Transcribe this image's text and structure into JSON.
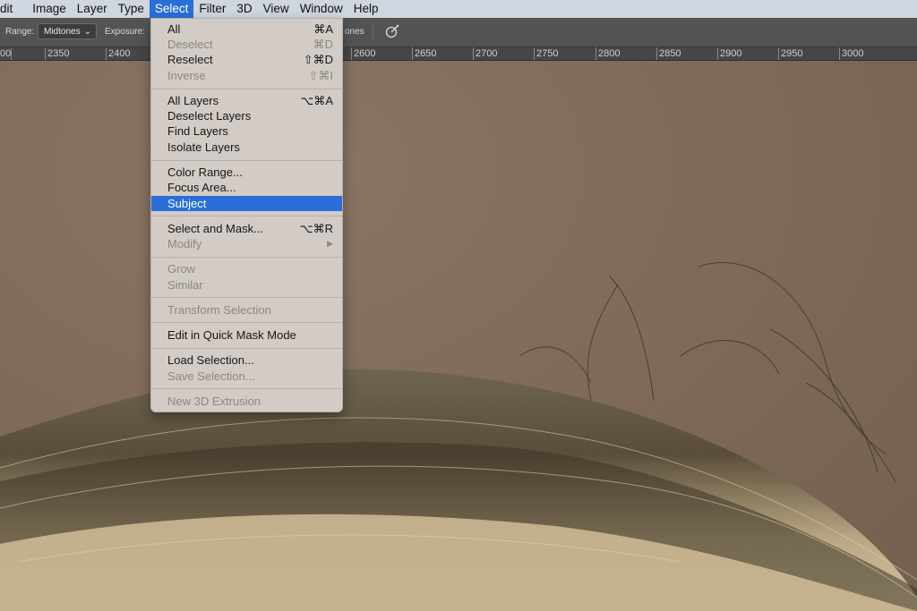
{
  "menubar": {
    "items": [
      {
        "label": "dit"
      },
      {
        "label": "Image"
      },
      {
        "label": "Layer"
      },
      {
        "label": "Type"
      },
      {
        "label": "Select",
        "active": true
      },
      {
        "label": "Filter"
      },
      {
        "label": "3D"
      },
      {
        "label": "View"
      },
      {
        "label": "Window"
      },
      {
        "label": "Help"
      }
    ]
  },
  "options": {
    "range_label": "Range:",
    "range_value": "Midtones",
    "exposure_label": "Exposure:",
    "protect_tones_label": "ones",
    "airbrush_icon": "airbrush-icon"
  },
  "ruler": {
    "labels": [
      "00",
      "2350",
      "2400",
      "2600",
      "2650",
      "2700",
      "2750",
      "2800",
      "2850",
      "2900",
      "2950",
      "3000"
    ]
  },
  "select_menu": {
    "groups": [
      [
        {
          "label": "All",
          "shortcut": "⌘A",
          "enabled": true
        },
        {
          "label": "Deselect",
          "shortcut": "⌘D",
          "enabled": false
        },
        {
          "label": "Reselect",
          "shortcut": "⇧⌘D",
          "enabled": true
        },
        {
          "label": "Inverse",
          "shortcut": "⇧⌘I",
          "enabled": false
        }
      ],
      [
        {
          "label": "All Layers",
          "shortcut": "⌥⌘A",
          "enabled": true
        },
        {
          "label": "Deselect Layers",
          "shortcut": "",
          "enabled": true
        },
        {
          "label": "Find Layers",
          "shortcut": "",
          "enabled": true
        },
        {
          "label": "Isolate Layers",
          "shortcut": "",
          "enabled": true
        }
      ],
      [
        {
          "label": "Color Range...",
          "shortcut": "",
          "enabled": true
        },
        {
          "label": "Focus Area...",
          "shortcut": "",
          "enabled": true
        },
        {
          "label": "Subject",
          "shortcut": "",
          "enabled": true,
          "highlighted": true
        }
      ],
      [
        {
          "label": "Select and Mask...",
          "shortcut": "⌥⌘R",
          "enabled": true
        },
        {
          "label": "Modify",
          "shortcut": "▶",
          "enabled": false
        }
      ],
      [
        {
          "label": "Grow",
          "shortcut": "",
          "enabled": false
        },
        {
          "label": "Similar",
          "shortcut": "",
          "enabled": false
        }
      ],
      [
        {
          "label": "Transform Selection",
          "shortcut": "",
          "enabled": false
        }
      ],
      [
        {
          "label": "Edit in Quick Mask Mode",
          "shortcut": "",
          "enabled": true
        }
      ],
      [
        {
          "label": "Load Selection...",
          "shortcut": "",
          "enabled": true
        },
        {
          "label": "Save Selection...",
          "shortcut": "",
          "enabled": false
        }
      ],
      [
        {
          "label": "New 3D Extrusion",
          "shortcut": "",
          "enabled": false
        }
      ]
    ]
  },
  "colors": {
    "accent": "#2a6ed9",
    "canvas_background": "#7f6a59",
    "menubar": "#cfd6df",
    "menu_background": "#d3ccc6"
  }
}
